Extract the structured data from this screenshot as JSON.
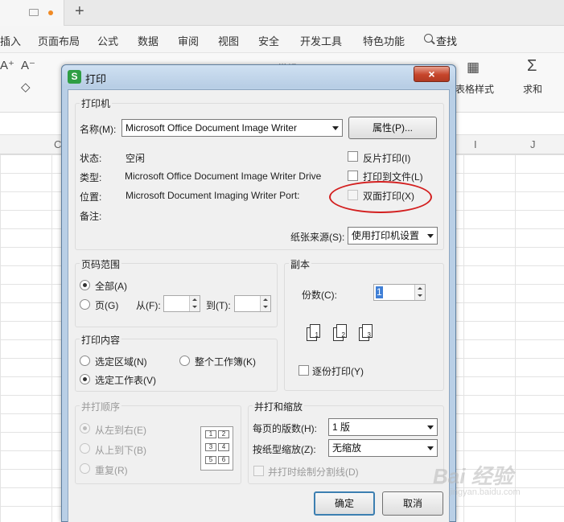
{
  "app": {
    "new_tab_symbol": "+",
    "menu": [
      "插入",
      "页面布局",
      "公式",
      "数据",
      "审阅",
      "视图",
      "安全",
      "开发工具",
      "特色功能"
    ],
    "search_label": "查找",
    "ribbon_labels": {
      "table_style": "表格样式",
      "sum": "求和",
      "style_combo": "常规"
    },
    "columns": [
      "C",
      "I",
      "J"
    ]
  },
  "dialog": {
    "title": "打印",
    "app_icon_letter": "S",
    "close_symbol": "×",
    "printer_group": {
      "title": "打印机",
      "name_label": "名称(M):",
      "name_value": "Microsoft Office Document Image Writer",
      "properties_button": "属性(P)...",
      "status_label": "状态:",
      "status_value": "空闲",
      "type_label": "类型:",
      "type_value": "Microsoft Office Document Image Writer Drive",
      "location_label": "位置:",
      "location_value": "Microsoft Document Imaging Writer Port:",
      "comment_label": "备注:",
      "reverse_print": "反片打印(I)",
      "print_to_file": "打印到文件(L)",
      "duplex_print": "双面打印(X)",
      "paper_source_label": "纸张来源(S):",
      "paper_source_value": "使用打印机设置"
    },
    "range_group": {
      "title": "页码范围",
      "all": "全部(A)",
      "pages": "页(G)",
      "from_label": "从(F):",
      "to_label": "到(T):"
    },
    "copies_group": {
      "title": "副本",
      "count_label": "份数(C):",
      "count_value": "1",
      "collate": "逐份打印(Y)",
      "collate_pages": [
        "1",
        "2",
        "3"
      ]
    },
    "content_group": {
      "title": "打印内容",
      "selection": "选定区域(N)",
      "workbook": "整个工作簿(K)",
      "sheet": "选定工作表(V)"
    },
    "order_group": {
      "title": "并打顺序",
      "left_to_right": "从左到右(E)",
      "top_to_bottom": "从上到下(B)",
      "repeat": "重复(R)",
      "cells": [
        "1",
        "2",
        "3",
        "4",
        "5",
        "6"
      ]
    },
    "scale_group": {
      "title": "并打和缩放",
      "pages_per_sheet_label": "每页的版数(H):",
      "pages_per_sheet_value": "1 版",
      "scale_to_paper_label": "按纸型缩放(Z):",
      "scale_to_paper_value": "无缩放",
      "draw_borders": "并打时绘制分割线(D)"
    },
    "ok_button": "确定",
    "cancel_button": "取消"
  },
  "annotation_color": "#d31f1f",
  "watermark": {
    "main": "Bai 经验",
    "sub": "jingyan.baidu.com"
  }
}
